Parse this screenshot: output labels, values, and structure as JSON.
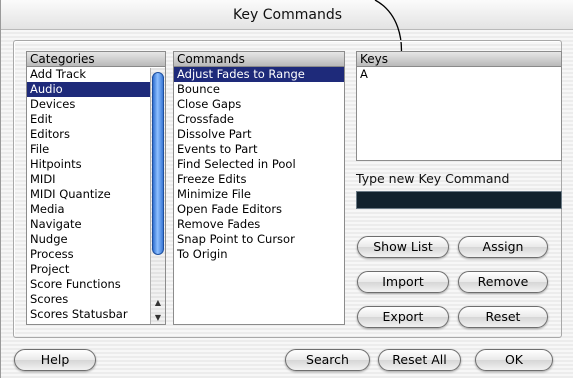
{
  "window": {
    "title": "Key Commands"
  },
  "categories": {
    "header": "Categories",
    "items": [
      "Add Track",
      "Audio",
      "Devices",
      "Edit",
      "Editors",
      "File",
      "Hitpoints",
      "MIDI",
      "MIDI Quantize",
      "Media",
      "Navigate",
      "Nudge",
      "Process",
      "Project",
      "Score Functions",
      "Scores",
      "Scores Statusbar"
    ],
    "selected_index": 1
  },
  "commands": {
    "header": "Commands",
    "items": [
      "Adjust Fades to Range",
      "Bounce",
      "Close Gaps",
      "Crossfade",
      "Dissolve Part",
      "Events to Part",
      "Find Selected in Pool",
      "Freeze Edits",
      "Minimize File",
      "Open Fade Editors",
      "Remove Fades",
      "Snap Point to Cursor",
      "To Origin"
    ],
    "selected_index": 0
  },
  "keys": {
    "header": "Keys",
    "items": [
      "A"
    ]
  },
  "new_key": {
    "label": "Type new Key Command",
    "value": ""
  },
  "buttons": {
    "show_list": "Show List",
    "assign": "Assign",
    "import": "Import",
    "remove": "Remove",
    "export": "Export",
    "reset": "Reset",
    "help": "Help",
    "search": "Search",
    "reset_all": "Reset All",
    "ok": "OK"
  },
  "icons": {
    "scroll_up": "scroll-up-arrow-icon",
    "scroll_down": "scroll-down-arrow-icon",
    "callout": "callout-arrow-icon"
  }
}
